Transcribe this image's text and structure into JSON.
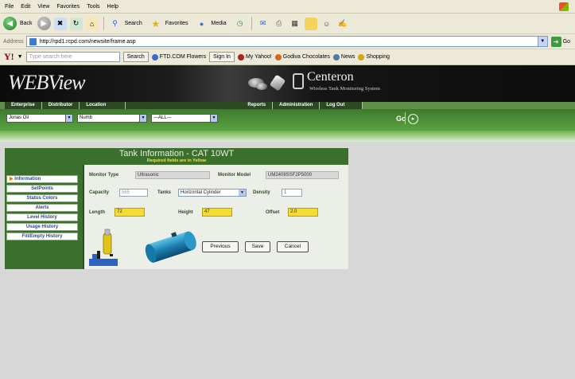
{
  "browser": {
    "menu": [
      "File",
      "Edit",
      "View",
      "Favorites",
      "Tools",
      "Help"
    ],
    "nav": {
      "back_label": "Back",
      "search_label": "Search",
      "favorites_label": "Favorites",
      "media_label": "Media"
    },
    "address": {
      "label": "Address",
      "url": "http://rpd1.rcpd.com/newsite/frame.asp",
      "go_label": "Go"
    },
    "yahoo": {
      "logo": "Y!",
      "search_placeholder": "Type search here",
      "search_button": "Search",
      "items": [
        "FTD.COM Flowers",
        "Sign In",
        "My Yahoo!",
        "Godiva Chocolates",
        "News",
        "Shopping"
      ]
    }
  },
  "app": {
    "logo_text": "WEBView",
    "brand_title": "Centeron",
    "brand_subtitle": "Wireless Tank Monitoring System",
    "tabs": [
      "Enterprise",
      "Distributor",
      "Location",
      "Reports",
      "Administration",
      "Log Out"
    ],
    "filters": {
      "enterprise_value": "Jonas Oil",
      "distributor_value": "Numb",
      "location_value": "---ALL---",
      "go_label": "Go",
      "go_icon": "▸"
    }
  },
  "panel": {
    "title": "Tank Information - CAT 10WT",
    "subtitle": "Required fields are in Yellow",
    "side_nav": [
      {
        "label": "Information",
        "active": true
      },
      {
        "label": "SetPoints",
        "active": false
      },
      {
        "label": "Status Colors",
        "active": false
      },
      {
        "label": "Alerts",
        "active": false
      },
      {
        "label": "Level History",
        "active": false
      },
      {
        "label": "Usage History",
        "active": false
      },
      {
        "label": "Fill/Empty History",
        "active": false
      }
    ],
    "form": {
      "monitor_type_label": "Monitor Type",
      "monitor_type_value": "Ultrasonic",
      "monitor_model_label": "Monitor Model",
      "monitor_model_value": "UM2408SSF2P5000",
      "capacity_label": "Capacity",
      "capacity_value": "565",
      "tanks_label": "Tanks",
      "tanks_value": "Horizontal Cylinder",
      "density_label": "Density",
      "density_value": "1",
      "length_label": "Length",
      "length_value": "72",
      "height_label": "Height",
      "height_value": "47",
      "offset_label": "Offset",
      "offset_value": "2.0"
    },
    "buttons": {
      "previous": "Previous",
      "save": "Save",
      "cancel": "Cancel"
    }
  },
  "colors": {
    "header_bg": "#0d0d0d",
    "tab_green": "#2c4a22",
    "filter_green": "#4a8e36",
    "panel_green": "#3b6f2c",
    "required_yellow": "#f5dc34",
    "page_gray": "#d7d7d7"
  }
}
